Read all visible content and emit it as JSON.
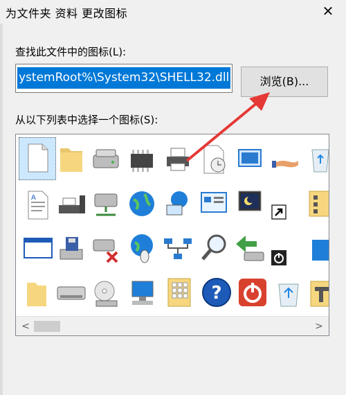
{
  "dialog": {
    "title": "为文件夹 资料 更改图标",
    "close_glyph": "✕"
  },
  "path_section": {
    "label": "查找此文件中的图标(L):",
    "path_value": "ystemRoot%\\System32\\SHELL32.dll",
    "browse_label": "浏览(B)..."
  },
  "icon_section": {
    "label": "从以下列表中选择一个图标(S):",
    "selected_icon": "blank-document-icon",
    "icons_row1": [
      "blank-document-icon",
      "folder-icon",
      "hard-drive-icon",
      "memory-chip-icon",
      "printer-icon",
      "clock-document-icon",
      "window-stack-icon",
      "sharing-hand-icon",
      "recycle-bin-icon"
    ],
    "icons_row2": [
      "text-document-icon",
      "network-printer-icon",
      "network-drive-icon",
      "globe-icon",
      "network-globe-icon",
      "control-panel-icon",
      "moon-monitor-icon",
      "shortcut-arrow-icon",
      "folder-settings-icon"
    ],
    "icons_row3": [
      "window-icon",
      "floppy-drive-icon",
      "network-drive-error-icon",
      "globe-mouse-icon",
      "network-topology-icon",
      "magnifier-icon",
      "green-arrow-drive-icon",
      "power-badge-icon",
      "blue-square-icon"
    ],
    "icons_row4": [
      "folder-small-icon",
      "drive-icon",
      "cd-drive-icon",
      "computer-icon",
      "grid-folder-icon",
      "help-icon",
      "power-button-icon",
      "recycle-bin-full-icon",
      "tools-folder-icon"
    ]
  },
  "scrollbar": {
    "left_arrow": "<",
    "right_arrow": ">"
  },
  "colors": {
    "selection": "#0078d7",
    "annotation_arrow": "#e53935"
  }
}
